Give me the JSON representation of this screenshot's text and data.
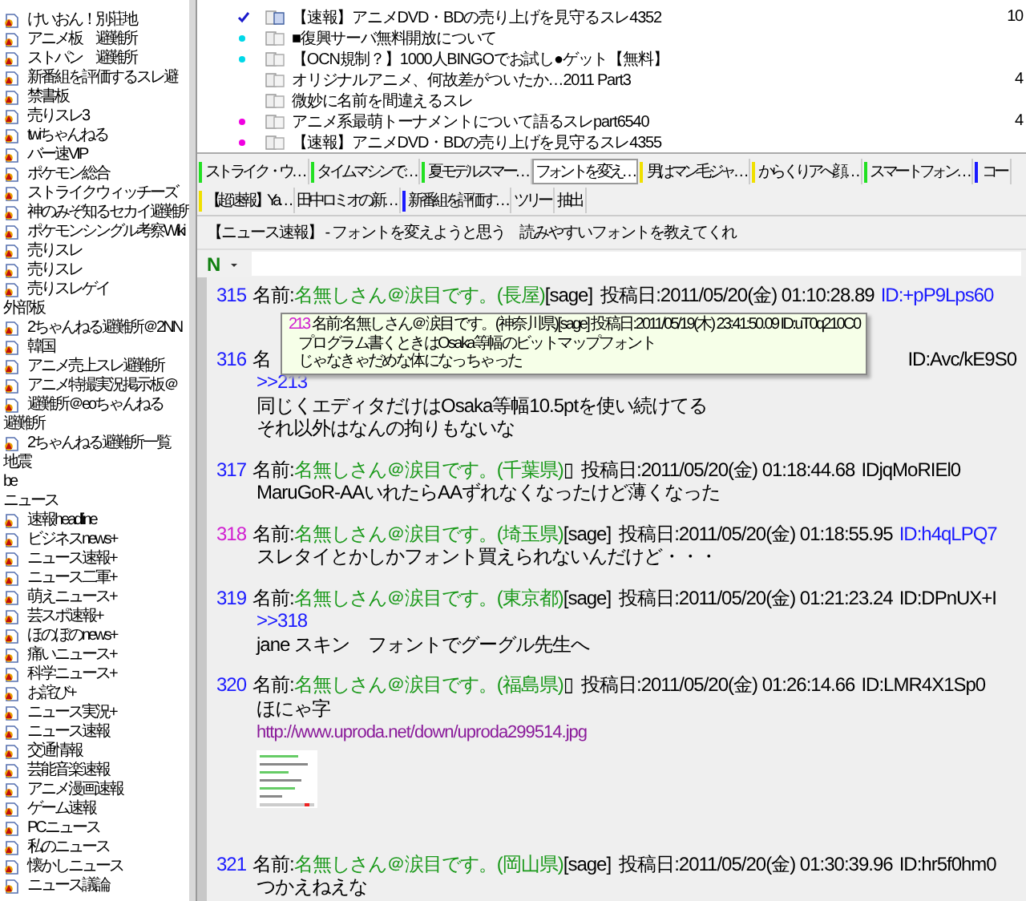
{
  "sidebar": {
    "items": [
      {
        "kind": "board",
        "label": "けいおん！別荘地"
      },
      {
        "kind": "board",
        "label": "アニメ板　避難所"
      },
      {
        "kind": "board",
        "label": "ストパン　避難所"
      },
      {
        "kind": "board",
        "label": "新番組を評価するスレ避"
      },
      {
        "kind": "board",
        "label": "禁書板"
      },
      {
        "kind": "board",
        "label": "売りスレ3"
      },
      {
        "kind": "board",
        "label": "twiちゃんねる"
      },
      {
        "kind": "board",
        "label": "バー速VIP"
      },
      {
        "kind": "board",
        "label": "ポケモン総合"
      },
      {
        "kind": "board",
        "label": "ストライクウィッチーズ"
      },
      {
        "kind": "board",
        "label": "神のみぞ知るセカイ避難所"
      },
      {
        "kind": "board",
        "label": "ポケモンシングル考察Wiki"
      },
      {
        "kind": "board",
        "label": "売りスレ"
      },
      {
        "kind": "board",
        "label": "売りスレ"
      },
      {
        "kind": "board",
        "label": "売りスレゲイ"
      },
      {
        "kind": "category",
        "label": "外部板"
      },
      {
        "kind": "board",
        "label": "2ちゃんねる避難所＠2NN"
      },
      {
        "kind": "board",
        "label": "韓国"
      },
      {
        "kind": "board",
        "label": "アニメ売上スレ避難所"
      },
      {
        "kind": "board",
        "label": "アニメ特撮実況掲示板＠"
      },
      {
        "kind": "board",
        "label": "避難所＠eoちゃんねる"
      },
      {
        "kind": "category",
        "label": "避難所"
      },
      {
        "kind": "board",
        "label": "2ちゃんねる避難所一覧"
      },
      {
        "kind": "category",
        "label": "地震"
      },
      {
        "kind": "category",
        "label": "be"
      },
      {
        "kind": "category",
        "label": "ニュース"
      },
      {
        "kind": "board",
        "label": "速報headline"
      },
      {
        "kind": "board",
        "label": "ビジネスnews+"
      },
      {
        "kind": "board",
        "label": "ニュース速報+"
      },
      {
        "kind": "board",
        "label": "ニュース二軍+"
      },
      {
        "kind": "board",
        "label": "萌えニュース+"
      },
      {
        "kind": "board",
        "label": "芸スポ速報+"
      },
      {
        "kind": "board",
        "label": "ほのぼのnews+"
      },
      {
        "kind": "board",
        "label": "痛いニュース+"
      },
      {
        "kind": "board",
        "label": "科学ニュース+"
      },
      {
        "kind": "board",
        "label": "お詫び+"
      },
      {
        "kind": "board",
        "label": "ニュース実況+"
      },
      {
        "kind": "board",
        "label": "ニュース速報"
      },
      {
        "kind": "board",
        "label": "交通情報"
      },
      {
        "kind": "board",
        "label": "芸能音楽速報"
      },
      {
        "kind": "board",
        "label": "アニメ漫画速報"
      },
      {
        "kind": "board",
        "label": "ゲーム速報"
      },
      {
        "kind": "board",
        "label": "PCニュース"
      },
      {
        "kind": "board",
        "label": "私のニュース"
      },
      {
        "kind": "board",
        "label": "懐かしニュース"
      },
      {
        "kind": "board",
        "label": "ニュース議論"
      }
    ]
  },
  "threads": {
    "rows": [
      {
        "checked": true,
        "has_log": true,
        "title": "【速報】アニメDVD・BDの売り上げを見守るスレ4352",
        "count": "10"
      },
      {
        "checked": false,
        "color": "#00d8e8",
        "has_log": false,
        "title": "■復興サーバ無料開放について"
      },
      {
        "checked": false,
        "color": "#00d8e8",
        "has_log": false,
        "title": "【OCN規制？】1000人BINGOでお試し●ゲット【無料】"
      },
      {
        "checked": false,
        "has_log": false,
        "title": "オリジナルアニメ、何故差がついたか…2011 Part3",
        "count": "4"
      },
      {
        "checked": false,
        "has_log": false,
        "title": "微妙に名前を間違えるスレ"
      },
      {
        "checked": false,
        "color": "#f000e0",
        "has_log": false,
        "title": "アニメ系最萌トーナメントについて語るスレpart6540",
        "count": "4"
      },
      {
        "checked": false,
        "color": "#f000e0",
        "has_log": false,
        "title": "【速報】アニメDVD・BDの売り上げを見守るスレ4355"
      }
    ]
  },
  "tab_bar": {
    "rows": [
      {
        "tabs": [
          {
            "label": "ストライク・ウ…",
            "selected": false,
            "color": "#22e022"
          },
          {
            "label": "タイムマシンで…",
            "selected": false,
            "color": "#22e022"
          },
          {
            "label": "夏モデルスマー…",
            "selected": false,
            "color": "#22e022"
          },
          {
            "label": "フォントを変え…",
            "selected": true
          },
          {
            "label": "男はマン毛ジャ…",
            "selected": false,
            "color": "#f0e000"
          },
          {
            "label": "からくりアへ顔…",
            "selected": false,
            "color": "#f0e000"
          },
          {
            "label": "スマートフォン…",
            "selected": false,
            "color": "#22e022"
          },
          {
            "label": "コー",
            "selected": false,
            "color": "#1a1aff"
          }
        ]
      },
      {
        "tabs": [
          {
            "label": "【超速報】Ya…",
            "selected": false,
            "color": "#f0e000"
          },
          {
            "label": "田中ロミオの新…",
            "selected": false
          },
          {
            "label": "新番組を評価す…",
            "selected": false,
            "color": "#1a1aff"
          },
          {
            "label": "ツリー",
            "selected": false
          },
          {
            "label": "抽出",
            "selected": false
          }
        ]
      }
    ]
  },
  "thread_title": "【ニュース速報】 - フォントを変えようと思う　読みやすいフォントを教えてくれ",
  "toolbar": {
    "name_icon": "N"
  },
  "posts": [
    {
      "kind": "full",
      "number": "315",
      "color": "#1a1aff",
      "name_label": "名前:",
      "name": "名無しさん＠涙目です。(長屋)",
      "mail": "[sage]",
      "date_label": "投稿日:",
      "date": "2011/05/20(金) 01:10:28.89",
      "id": "ID:+pP9Lps60",
      "id_linked": true,
      "popup": {
        "number": "213",
        "header": "名前:名無しさん＠涙目です。(神奈川県)[sage] 投稿日:2011/05/19(木) 23:41:50.09 ID:uT0q210C0",
        "lines": [
          "プログラム書くときはOsaka等幅のビットマップフォント",
          "じゃなきゃだめな体になっちゃった"
        ]
      }
    },
    {
      "kind": "covered",
      "number": "316",
      "color": "#1a1aff",
      "name_label": "名",
      "id": "ID:Avc/kE9S0",
      "id_linked": false,
      "body": [
        {
          "kind": "anchor",
          "text": ">>213"
        },
        {
          "kind": "text",
          "text": "同じくエディタだけはOsaka等幅10.5ptを使い続けてる"
        },
        {
          "kind": "text",
          "text": "それ以外はなんの拘りもないな"
        }
      ]
    },
    {
      "kind": "full",
      "number": "317",
      "color": "#1a1aff",
      "name_label": "名前:",
      "name": "名無しさん＠涙目です。(千葉県)",
      "mail": "▯",
      "date_label": "投稿日:",
      "date": "2011/05/20(金) 01:18:44.68",
      "id": "IDjqMoRIEl0",
      "id_linked": false,
      "body": [
        {
          "kind": "text",
          "text": "MaruGoR-AAいれたらAAずれなくなったけど薄くなった"
        }
      ]
    },
    {
      "kind": "full",
      "number": "318",
      "color": "#d020d0",
      "name_label": "名前:",
      "name": "名無しさん＠涙目です。(埼玉県)",
      "mail": "[sage]",
      "date_label": "投稿日:",
      "date": "2011/05/20(金) 01:18:55.95",
      "id": "ID:h4qLPQ7",
      "id_linked": true,
      "body": [
        {
          "kind": "text",
          "text": "スレタイとかしかフォント買えられないんだけど・・・"
        }
      ]
    },
    {
      "kind": "full",
      "number": "319",
      "color": "#1a1aff",
      "name_label": "名前:",
      "name": "名無しさん＠涙目です。(東京都)",
      "mail": "[sage]",
      "date_label": "投稿日:",
      "date": "2011/05/20(金) 01:21:23.24",
      "id": "ID:DPnUX+I",
      "id_linked": false,
      "body": [
        {
          "kind": "anchor",
          "text": ">>318"
        },
        {
          "kind": "text",
          "text": "jane スキン　フォントでグーグル先生へ"
        }
      ]
    },
    {
      "kind": "full",
      "number": "320",
      "color": "#1a1aff",
      "name_label": "名前:",
      "name": "名無しさん＠涙目です。(福島県)",
      "mail": "▯",
      "date_label": "投稿日:",
      "date": "2011/05/20(金) 01:26:14.66",
      "id": "ID:LMR4X1Sp0",
      "id_linked": false,
      "body": [
        {
          "kind": "text",
          "text": "ほにゃ字"
        },
        {
          "kind": "link",
          "text": "http://www.uproda.net/down/uproda299514.jpg"
        },
        {
          "kind": "picture"
        }
      ]
    },
    {
      "kind": "full",
      "number": "321",
      "color": "#1a1aff",
      "name_label": "名前:",
      "name": "名無しさん＠涙目です。(岡山県)",
      "mail": "[sage]",
      "date_label": "投稿日:",
      "date": "2011/05/20(金) 01:30:39.96",
      "id": "ID:hr5f0hm0",
      "id_linked": false,
      "body": [
        {
          "kind": "text",
          "text": "つかえねえな"
        }
      ]
    }
  ]
}
